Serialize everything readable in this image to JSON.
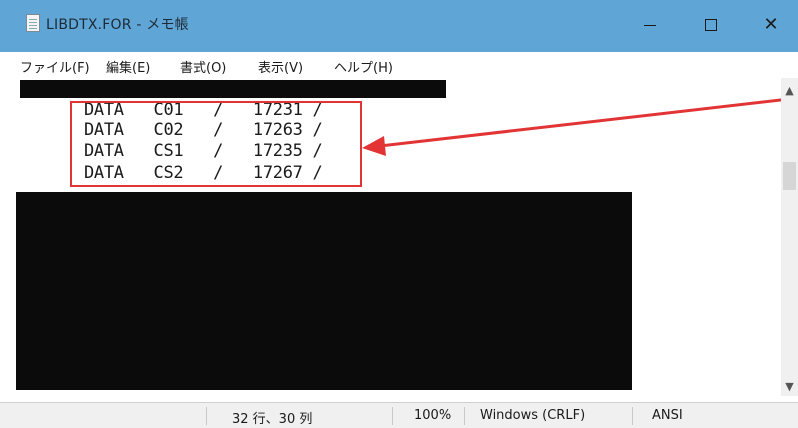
{
  "window": {
    "title": "LIBDTX.FOR - メモ帳",
    "minimize_label": "—",
    "maximize_label": "□",
    "close_label": "✕"
  },
  "menu": {
    "items": [
      {
        "label": "ファイル(F)"
      },
      {
        "label": "編集(E)"
      },
      {
        "label": "書式(O)"
      },
      {
        "label": "表示(V)"
      },
      {
        "label": "ヘルプ(H)"
      }
    ]
  },
  "editor": {
    "lines": [
      "DATA   C01   /   17231 /",
      "DATA   C02   /   17263 /",
      "DATA   CS1   /   17235 /",
      "DATA   CS2   /   17267 /"
    ]
  },
  "status": {
    "position": "32 行、30 列",
    "zoom": "100%",
    "line_ending": "Windows (CRLF)",
    "encoding": "ANSI"
  },
  "colors": {
    "titlebar": "#5fa6d6",
    "highlight": "#e23434",
    "redaction": "#0b0b0b"
  }
}
